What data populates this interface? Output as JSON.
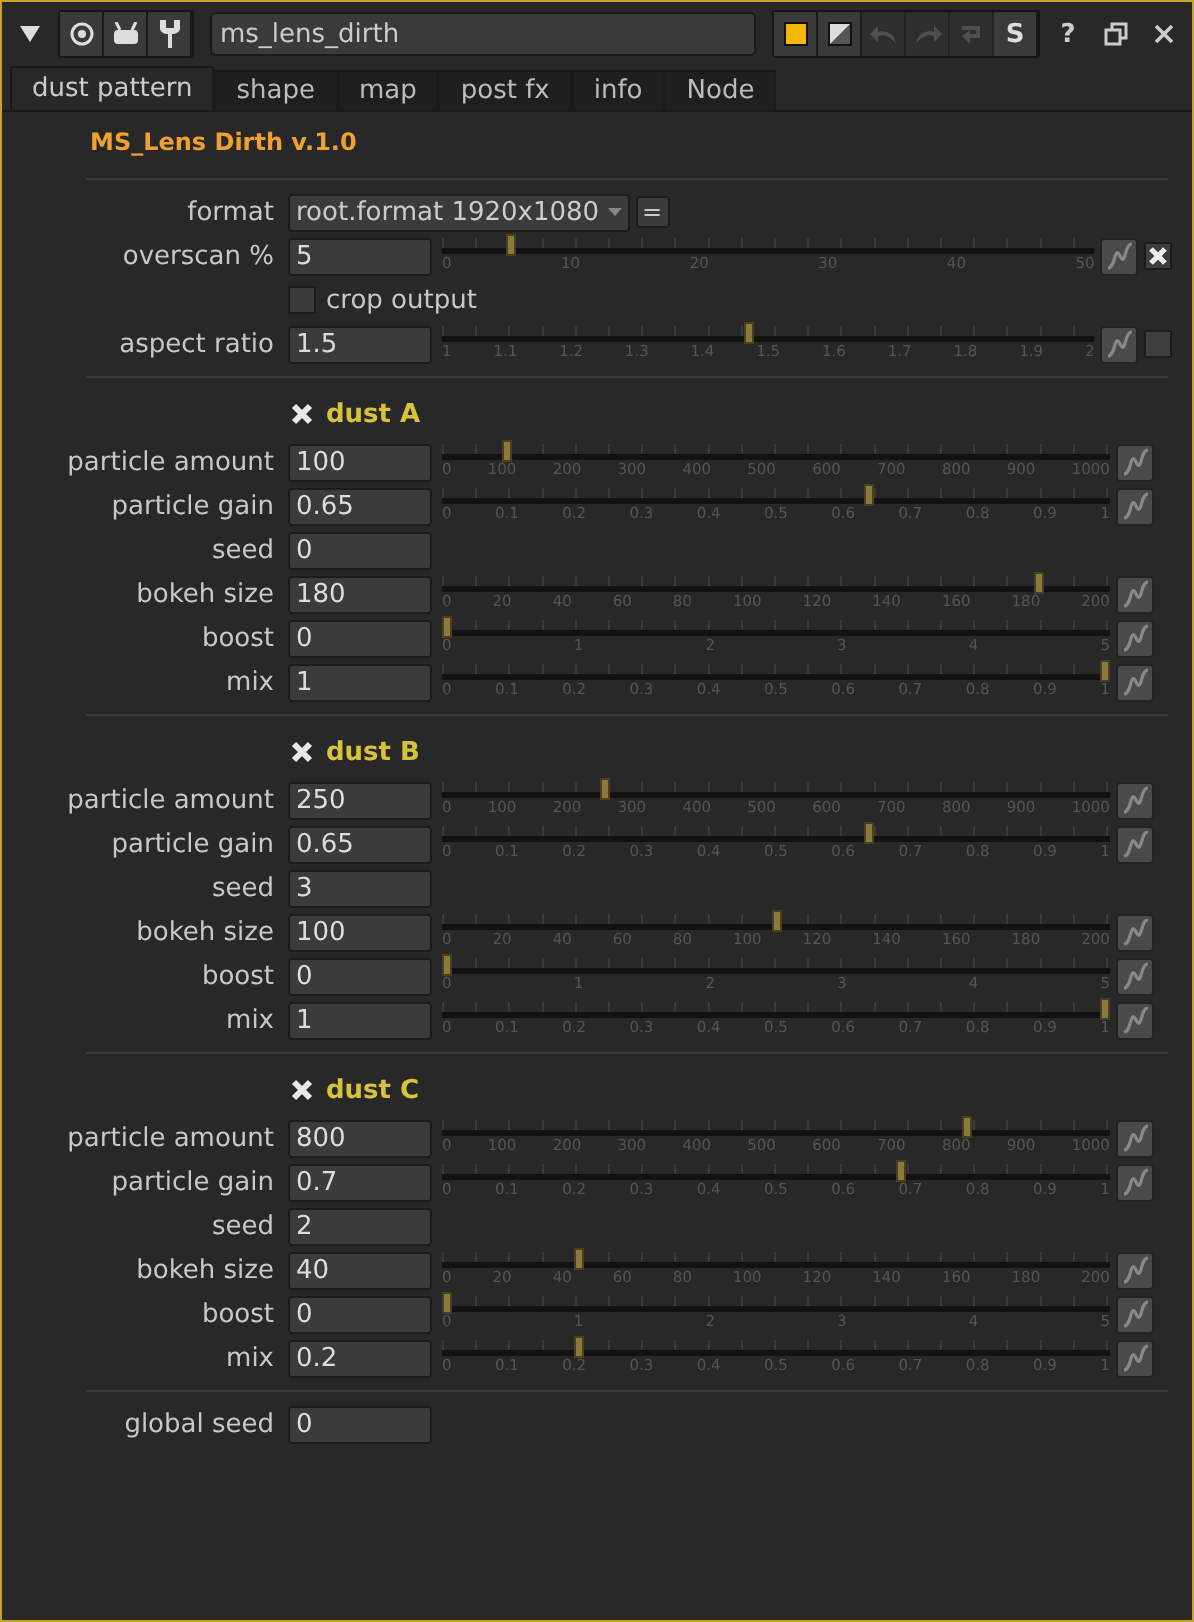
{
  "header": {
    "node_name": "ms_lens_dirth",
    "actions": [
      {
        "kind": "color",
        "disabled": false
      },
      {
        "kind": "mask",
        "disabled": false
      },
      {
        "kind": "undo",
        "disabled": true
      },
      {
        "kind": "redo",
        "disabled": true
      },
      {
        "kind": "revert",
        "disabled": true
      },
      {
        "kind": "text",
        "text": "S",
        "disabled": false
      }
    ],
    "help": "?"
  },
  "tabs": [
    {
      "label": "dust pattern",
      "selected": true
    },
    {
      "label": "shape",
      "selected": false
    },
    {
      "label": "map",
      "selected": false
    },
    {
      "label": "post fx",
      "selected": false
    },
    {
      "label": "info",
      "selected": false
    },
    {
      "label": "Node",
      "selected": false
    }
  ],
  "title": "MS_Lens Dirth v.1.0",
  "format": {
    "label": "format",
    "value": "root.format 1920x1080",
    "button": "="
  },
  "overscan": {
    "label": "overscan %",
    "value": "5",
    "level": 0.1,
    "ticks": [
      "0",
      "10",
      "20",
      "30",
      "40",
      "50"
    ],
    "toggle_checked": true
  },
  "crop_output": {
    "label": "crop output",
    "checked": false
  },
  "aspect_ratio": {
    "label": "aspect ratio",
    "value": "1.5",
    "level": 0.47,
    "ticks": [
      "1",
      "1.1",
      "1.2",
      "1.3",
      "1.4",
      "1.5",
      "1.6",
      "1.7",
      "1.8",
      "1.9",
      "2"
    ],
    "toggle_checked": false
  },
  "groups": [
    {
      "title": "dust A",
      "checked": true,
      "rows": [
        {
          "kind": "slider",
          "label": "particle amount",
          "value": "100",
          "level": 0.09,
          "ticks": [
            "0",
            "100",
            "200",
            "300",
            "400",
            "500",
            "600",
            "700",
            "800",
            "900",
            "1000"
          ]
        },
        {
          "kind": "slider",
          "label": "particle gain",
          "value": "0.65",
          "level": 0.64,
          "ticks": [
            "0",
            "0.1",
            "0.2",
            "0.3",
            "0.4",
            "0.5",
            "0.6",
            "0.7",
            "0.8",
            "0.9",
            "1"
          ]
        },
        {
          "kind": "field",
          "label": "seed",
          "value": "0"
        },
        {
          "kind": "slider",
          "label": "bokeh size",
          "value": "180",
          "level": 0.9,
          "ticks": [
            "0",
            "20",
            "40",
            "60",
            "80",
            "100",
            "120",
            "140",
            "160",
            "180",
            "200"
          ]
        },
        {
          "kind": "slider",
          "label": "boost",
          "value": "0",
          "level": 0,
          "ticks": [
            "0",
            "1",
            "2",
            "3",
            "4",
            "5"
          ]
        },
        {
          "kind": "slider",
          "label": "mix",
          "value": "1",
          "level": 1,
          "ticks": [
            "0",
            "0.1",
            "0.2",
            "0.3",
            "0.4",
            "0.5",
            "0.6",
            "0.7",
            "0.8",
            "0.9",
            "1"
          ]
        }
      ]
    },
    {
      "title": "dust B",
      "checked": true,
      "rows": [
        {
          "kind": "slider",
          "label": "particle amount",
          "value": "250",
          "level": 0.24,
          "ticks": [
            "0",
            "100",
            "200",
            "300",
            "400",
            "500",
            "600",
            "700",
            "800",
            "900",
            "1000"
          ]
        },
        {
          "kind": "slider",
          "label": "particle gain",
          "value": "0.65",
          "level": 0.64,
          "ticks": [
            "0",
            "0.1",
            "0.2",
            "0.3",
            "0.4",
            "0.5",
            "0.6",
            "0.7",
            "0.8",
            "0.9",
            "1"
          ]
        },
        {
          "kind": "field",
          "label": "seed",
          "value": "3"
        },
        {
          "kind": "slider",
          "label": "bokeh size",
          "value": "100",
          "level": 0.5,
          "ticks": [
            "0",
            "20",
            "40",
            "60",
            "80",
            "100",
            "120",
            "140",
            "160",
            "180",
            "200"
          ]
        },
        {
          "kind": "slider",
          "label": "boost",
          "value": "0",
          "level": 0,
          "ticks": [
            "0",
            "1",
            "2",
            "3",
            "4",
            "5"
          ]
        },
        {
          "kind": "slider",
          "label": "mix",
          "value": "1",
          "level": 1,
          "ticks": [
            "0",
            "0.1",
            "0.2",
            "0.3",
            "0.4",
            "0.5",
            "0.6",
            "0.7",
            "0.8",
            "0.9",
            "1"
          ]
        }
      ]
    },
    {
      "title": "dust C",
      "checked": true,
      "rows": [
        {
          "kind": "slider",
          "label": "particle amount",
          "value": "800",
          "level": 0.79,
          "ticks": [
            "0",
            "100",
            "200",
            "300",
            "400",
            "500",
            "600",
            "700",
            "800",
            "900",
            "1000"
          ]
        },
        {
          "kind": "slider",
          "label": "particle gain",
          "value": "0.7",
          "level": 0.69,
          "ticks": [
            "0",
            "0.1",
            "0.2",
            "0.3",
            "0.4",
            "0.5",
            "0.6",
            "0.7",
            "0.8",
            "0.9",
            "1"
          ]
        },
        {
          "kind": "field",
          "label": "seed",
          "value": "2"
        },
        {
          "kind": "slider",
          "label": "bokeh size",
          "value": "40",
          "level": 0.2,
          "ticks": [
            "0",
            "20",
            "40",
            "60",
            "80",
            "100",
            "120",
            "140",
            "160",
            "180",
            "200"
          ]
        },
        {
          "kind": "slider",
          "label": "boost",
          "value": "0",
          "level": 0,
          "ticks": [
            "0",
            "1",
            "2",
            "3",
            "4",
            "5"
          ]
        },
        {
          "kind": "slider",
          "label": "mix",
          "value": "0.2",
          "level": 0.2,
          "ticks": [
            "0",
            "0.1",
            "0.2",
            "0.3",
            "0.4",
            "0.5",
            "0.6",
            "0.7",
            "0.8",
            "0.9",
            "1"
          ]
        }
      ]
    }
  ],
  "global_seed": {
    "label": "global seed",
    "value": "0"
  }
}
